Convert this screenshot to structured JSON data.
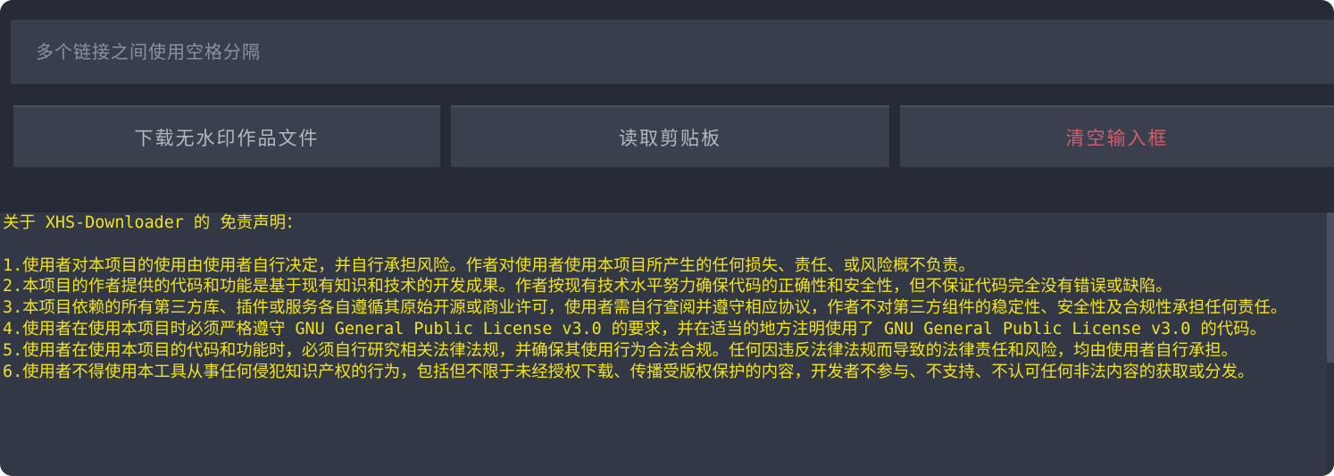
{
  "input": {
    "placeholder": "多个链接之间使用空格分隔"
  },
  "buttons": {
    "download": "下载无水印作品文件",
    "clipboard": "读取剪贴板",
    "clear": "清空输入框"
  },
  "colors": {
    "background": "#272b36",
    "panel": "#383e4c",
    "log_text": "#f2e21a",
    "clear_text": "#cf5f6c"
  },
  "log": {
    "title": "关于 XHS-Downloader 的 免责声明：",
    "lines": [
      "1.使用者对本项目的使用由使用者自行决定，并自行承担风险。作者对使用者使用本项目所产生的任何损失、责任、或风险概不负责。",
      "2.本项目的作者提供的代码和功能是基于现有知识和技术的开发成果。作者按现有技术水平努力确保代码的正确性和安全性，但不保证代码完全没有错误或缺陷。",
      "3.本项目依赖的所有第三方库、插件或服务各自遵循其原始开源或商业许可，使用者需自行查阅并遵守相应协议，作者不对第三方组件的稳定性、安全性及合规性承担任何责任。",
      "4.使用者在使用本项目时必须严格遵守 GNU General Public License v3.0 的要求，并在适当的地方注明使用了 GNU General Public License v3.0 的代码。",
      "5.使用者在使用本项目的代码和功能时，必须自行研究相关法律法规，并确保其使用行为合法合规。任何因违反法律法规而导致的法律责任和风险，均由使用者自行承担。",
      "6.使用者不得使用本工具从事任何侵犯知识产权的行为，包括但不限于未经授权下载、传播受版权保护的内容，开发者不参与、不支持、不认可任何非法内容的获取或分发。"
    ]
  }
}
